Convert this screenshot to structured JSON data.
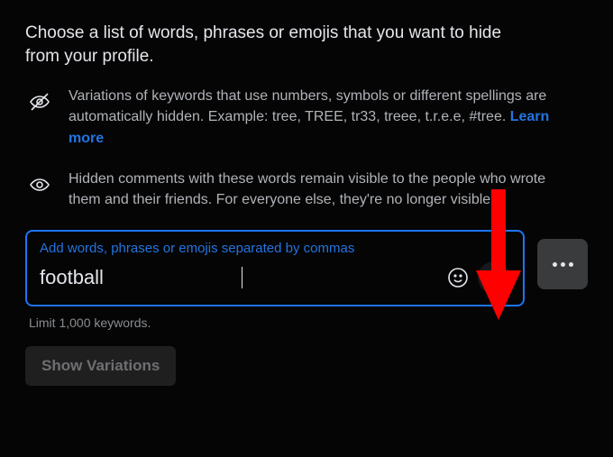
{
  "intro": "Choose a list of words, phrases or emojis that you want to hide from your profile.",
  "variations_info": {
    "text": "Variations of keywords that use numbers, symbols or different spellings are automatically hidden. Example: tree, TREE, tr33, treee, t.r.e.e, #tree. ",
    "link": "Learn more"
  },
  "visibility_info": "Hidden comments with these words remain visible to the people who wrote them and their friends. For everyone else, they're no longer visible.",
  "input": {
    "label": "Add words, phrases or emojis separated by commas",
    "value": "football"
  },
  "limit": "Limit 1,000 keywords.",
  "show_variations": "Show Variations"
}
